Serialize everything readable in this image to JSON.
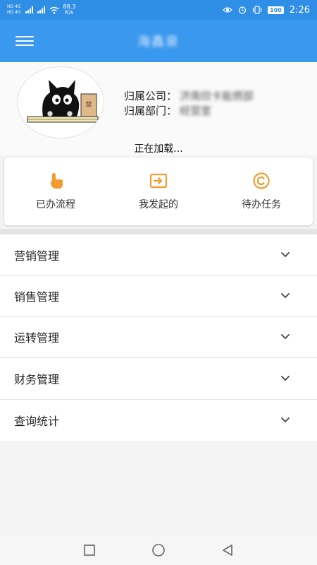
{
  "status": {
    "hd1": "HD 4G",
    "hd2": "HD 4G",
    "speed_value": "88.3",
    "speed_unit": "K/s",
    "battery": "100",
    "time": "2:26"
  },
  "appbar": {
    "title": "海鑫泉",
    "menu_icon": "hamburger-icon"
  },
  "profile": {
    "company_label": "归属公司：",
    "company_value": "济南欣卡能燃部",
    "dept_label": "归属部门：",
    "dept_value": "经营室",
    "loading_text": "正在加载..."
  },
  "quick_actions": [
    {
      "label": "已办流程",
      "icon": "hand-pointer-icon"
    },
    {
      "label": "我发起的",
      "icon": "send-box-icon"
    },
    {
      "label": "待办任务",
      "icon": "copyright-circle-icon"
    }
  ],
  "colors": {
    "accent": "#3a98ee",
    "icon_orange": "#f39c2d"
  },
  "menu": [
    {
      "label": "营销管理"
    },
    {
      "label": "销售管理"
    },
    {
      "label": "运转管理"
    },
    {
      "label": "财务管理"
    },
    {
      "label": "查询统计"
    }
  ]
}
